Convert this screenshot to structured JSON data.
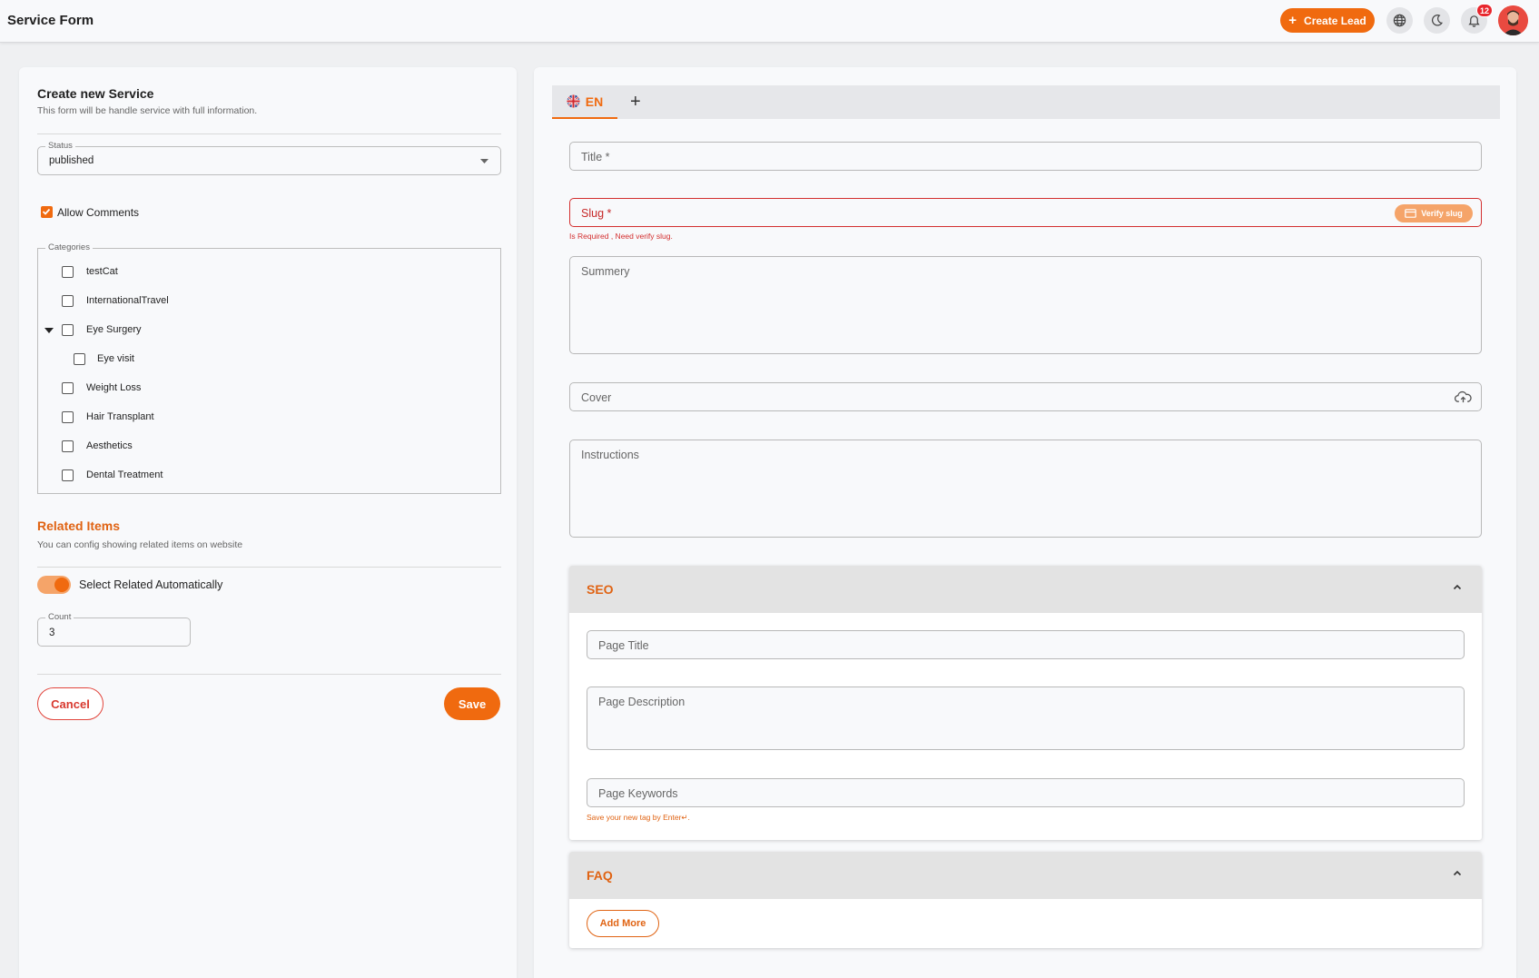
{
  "header": {
    "title": "Service Form",
    "create_lead_label": "Create Lead",
    "notification_count": "12",
    "icons": [
      "plus-icon",
      "globe-icon",
      "moon-icon",
      "bell-icon",
      "avatar"
    ]
  },
  "left": {
    "title": "Create new Service",
    "subtitle": "This form will be handle service with full information.",
    "status": {
      "legend": "Status",
      "value": "published"
    },
    "allow_comments": {
      "label": "Allow Comments",
      "checked": true
    },
    "categories": {
      "legend": "Categories",
      "items": [
        {
          "label": "testCat",
          "checked": false
        },
        {
          "label": "InternationalTravel",
          "checked": false
        },
        {
          "label": "Eye Surgery",
          "checked": false,
          "expanded": true
        },
        {
          "label": "Eye visit",
          "checked": false,
          "child": true
        },
        {
          "label": "Weight Loss",
          "checked": false
        },
        {
          "label": "Hair Transplant",
          "checked": false
        },
        {
          "label": "Aesthetics",
          "checked": false
        },
        {
          "label": "Dental Treatment",
          "checked": false
        }
      ]
    },
    "related": {
      "title": "Related Items",
      "subtitle": "You can config showing related items on website",
      "toggle_label": "Select Related Automatically",
      "toggle_on": true,
      "count_legend": "Count",
      "count_value": "3"
    },
    "cancel_label": "Cancel",
    "save_label": "Save"
  },
  "right": {
    "tabs": {
      "active": "EN",
      "add": "+"
    },
    "title_placeholder": "Title *",
    "slug_placeholder": "Slug *",
    "verify_label": "Verify slug",
    "slug_error": "Is Required , Need verify slug.",
    "summery_placeholder": "Summery",
    "cover_placeholder": "Cover",
    "instructions_placeholder": "Instructions",
    "seo": {
      "title": "SEO",
      "page_title": "Page Title",
      "page_description": "Page Description",
      "page_keywords": "Page Keywords",
      "keywords_hint": "Save your new tag by Enter↵."
    },
    "faq": {
      "title": "FAQ",
      "add_more": "Add More"
    }
  },
  "colors": {
    "accent": "#f06a0f",
    "error": "#d32f2f",
    "accent_light": "#f5a469"
  }
}
